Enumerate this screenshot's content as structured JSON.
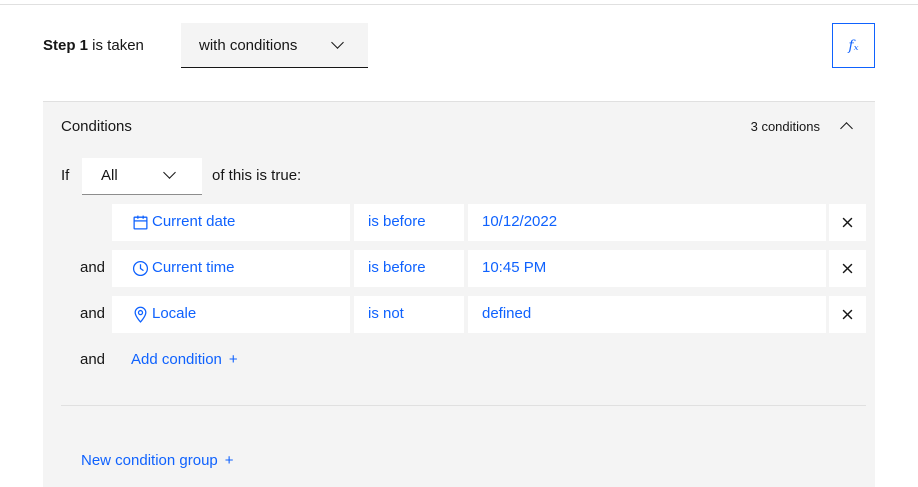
{
  "step": {
    "label_bold": "Step 1",
    "label_rest": " is taken",
    "dropdown_value": "with conditions",
    "fx_label": "fₓ"
  },
  "conditions_panel": {
    "title": "Conditions",
    "count": "3 conditions",
    "if_label": "If",
    "quantifier": "All",
    "suffix": "of this is true:",
    "rows": [
      {
        "prefix": "",
        "icon": "calendar-icon",
        "property": "Current date",
        "operator": "is before",
        "value": "10/12/2022"
      },
      {
        "prefix": "and",
        "icon": "clock-icon",
        "property": "Current time",
        "operator": "is before",
        "value": "10:45 PM"
      },
      {
        "prefix": "and",
        "icon": "location-icon",
        "property": "Locale",
        "operator": "is not",
        "value": "defined"
      }
    ],
    "add_row_prefix": "and",
    "add_condition": "Add condition",
    "plus_glyph": "+",
    "new_group": "New condition group"
  },
  "colors": {
    "accent": "#0f62fe",
    "panel_bg": "#f4f4f4",
    "text": "#161616"
  }
}
